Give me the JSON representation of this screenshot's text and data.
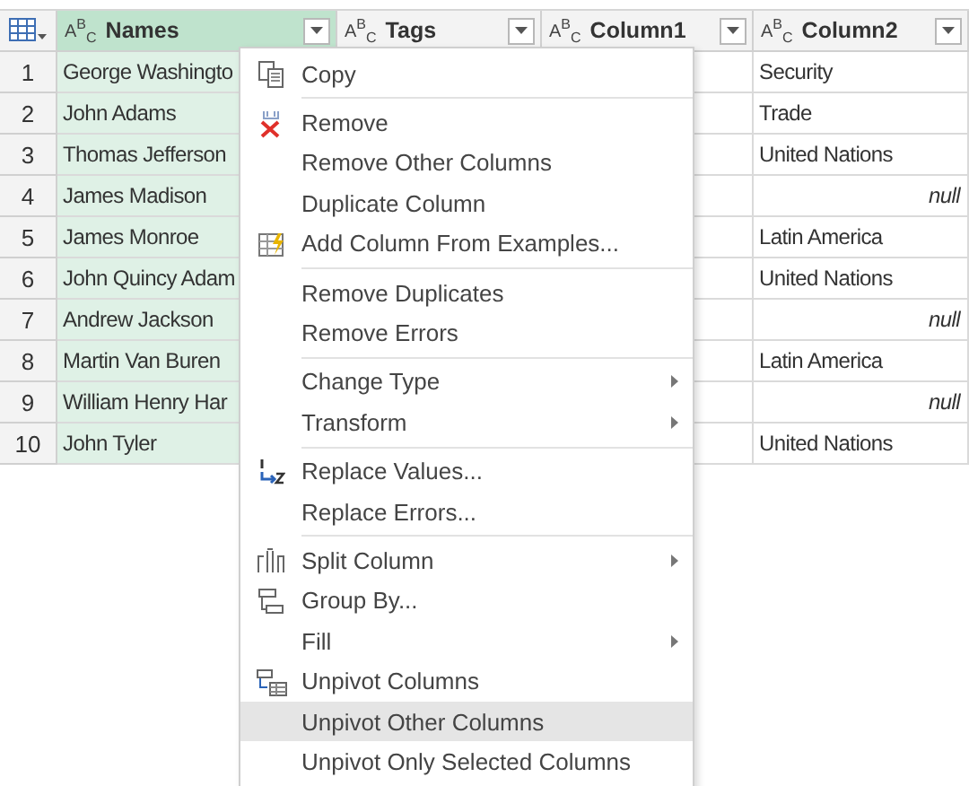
{
  "table": {
    "columns": [
      {
        "type_label": "A$^{B}$$_{C}$",
        "name": "Names",
        "selected": true
      },
      {
        "type_label": "A$^{B}$$_{C}$",
        "name": "Tags",
        "selected": false
      },
      {
        "type_label": "A$^{B}$$_{C}$",
        "name": "Column1",
        "selected": false
      },
      {
        "type_label": "A$^{B}$$_{C}$",
        "name": "Column2",
        "selected": false
      }
    ],
    "rows": [
      {
        "number": "1",
        "cells": [
          {
            "kind": "text",
            "text": "George Washingto"
          },
          null,
          null,
          {
            "kind": "text",
            "text": "Security"
          }
        ]
      },
      {
        "number": "2",
        "cells": [
          {
            "kind": "text",
            "text": "John Adams"
          },
          null,
          null,
          {
            "kind": "text",
            "text": "Trade"
          }
        ]
      },
      {
        "number": "3",
        "cells": [
          {
            "kind": "text",
            "text": "Thomas Jefferson"
          },
          null,
          null,
          {
            "kind": "text",
            "text": "United Nations"
          }
        ]
      },
      {
        "number": "4",
        "cells": [
          {
            "kind": "text",
            "text": "James Madison"
          },
          null,
          null,
          {
            "kind": "null",
            "text": "null"
          }
        ]
      },
      {
        "number": "5",
        "cells": [
          {
            "kind": "text",
            "text": "James Monroe"
          },
          null,
          null,
          {
            "kind": "text",
            "text": "Latin America"
          }
        ]
      },
      {
        "number": "6",
        "cells": [
          {
            "kind": "text",
            "text": "John Quincy Adam"
          },
          null,
          null,
          {
            "kind": "text",
            "text": "United Nations"
          }
        ]
      },
      {
        "number": "7",
        "cells": [
          {
            "kind": "text",
            "text": "Andrew Jackson"
          },
          null,
          null,
          {
            "kind": "null",
            "text": "null"
          }
        ]
      },
      {
        "number": "8",
        "cells": [
          {
            "kind": "text",
            "text": "Martin Van Buren"
          },
          null,
          null,
          {
            "kind": "text",
            "text": "Latin America"
          }
        ]
      },
      {
        "number": "9",
        "cells": [
          {
            "kind": "text",
            "text": "William Henry Har"
          },
          null,
          null,
          {
            "kind": "null",
            "text": "null"
          }
        ]
      },
      {
        "number": "10",
        "cells": [
          {
            "kind": "text",
            "text": "John Tyler"
          },
          null,
          null,
          {
            "kind": "text",
            "text": "United Nations"
          }
        ]
      }
    ]
  },
  "context_menu": {
    "groups": [
      [
        {
          "label": "Copy",
          "kind": "copy",
          "submenu": false,
          "selected": false
        }
      ],
      [
        {
          "label": "Remove",
          "kind": "remove",
          "submenu": false,
          "selected": false
        },
        {
          "label": "Remove Other Columns",
          "submenu": false,
          "selected": false
        },
        {
          "label": "Duplicate Column",
          "submenu": false,
          "selected": false
        },
        {
          "label": "Add Column From Examples...",
          "kind": "examples",
          "submenu": false,
          "selected": false
        }
      ],
      [
        {
          "label": "Remove Duplicates",
          "submenu": false,
          "selected": false
        },
        {
          "label": "Remove Errors",
          "submenu": false,
          "selected": false
        }
      ],
      [
        {
          "label": "Change Type",
          "submenu": true,
          "selected": false
        },
        {
          "label": "Transform",
          "submenu": true,
          "selected": false
        }
      ],
      [
        {
          "label": "Replace Values...",
          "kind": "replace",
          "submenu": false,
          "selected": false
        },
        {
          "label": "Replace Errors...",
          "submenu": false,
          "selected": false
        }
      ],
      [
        {
          "label": "Split Column",
          "kind": "split",
          "submenu": true,
          "selected": false
        },
        {
          "label": "Group By...",
          "kind": "group",
          "submenu": false,
          "selected": false
        },
        {
          "label": "Fill",
          "submenu": true,
          "selected": false
        },
        {
          "label": "Unpivot Columns",
          "kind": "unpivot",
          "submenu": false,
          "selected": false
        },
        {
          "label": "Unpivot Other Columns",
          "submenu": false,
          "selected": true
        },
        {
          "label": "Unpivot Only Selected Columns",
          "submenu": false,
          "selected": false
        }
      ]
    ]
  }
}
